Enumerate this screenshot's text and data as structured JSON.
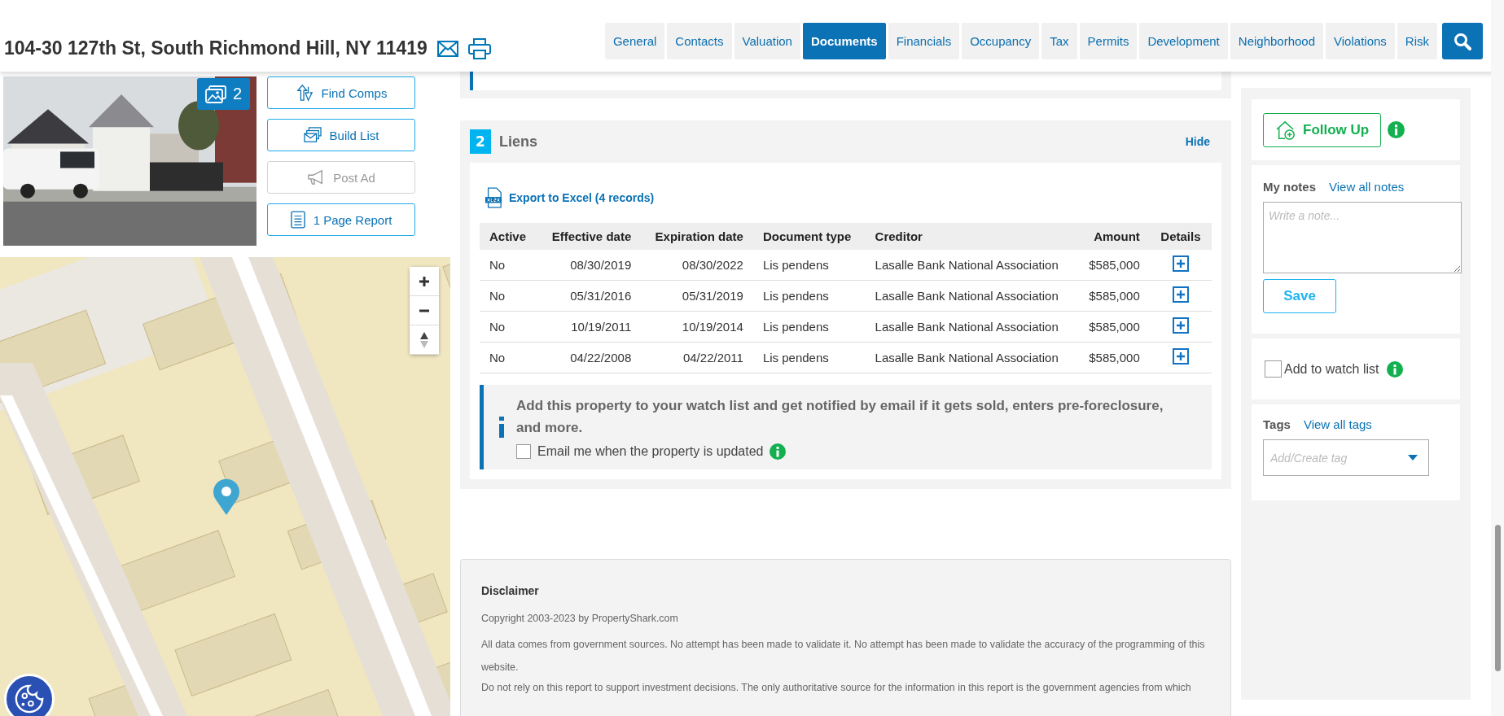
{
  "header": {
    "address": "104-30 127th St, South Richmond Hill, NY 11419"
  },
  "tabs": [
    {
      "label": "General",
      "selected": false
    },
    {
      "label": "Contacts",
      "selected": false
    },
    {
      "label": "Valuation",
      "selected": false
    },
    {
      "label": "Documents",
      "selected": true
    },
    {
      "label": "Financials",
      "selected": false
    },
    {
      "label": "Occupancy",
      "selected": false
    },
    {
      "label": "Tax",
      "selected": false
    },
    {
      "label": "Permits",
      "selected": false
    },
    {
      "label": "Development",
      "selected": false
    },
    {
      "label": "Neighborhood",
      "selected": false
    },
    {
      "label": "Violations",
      "selected": false
    },
    {
      "label": "Risk",
      "selected": false
    }
  ],
  "photo": {
    "gallery_count": "2"
  },
  "actions": [
    {
      "kind": "comps",
      "label": "Find Comps",
      "disabled": false
    },
    {
      "kind": "list",
      "label": "Build List",
      "disabled": false
    },
    {
      "kind": "ad",
      "label": "Post Ad",
      "disabled": true
    },
    {
      "kind": "report",
      "label": "1 Page Report",
      "disabled": false
    }
  ],
  "liens": {
    "number": "2",
    "title": "Liens",
    "hide": "Hide",
    "export": "Export to Excel (4 records)",
    "columns": [
      "Active",
      "Effective date",
      "Expiration date",
      "Document type",
      "Creditor",
      "Amount",
      "Details"
    ],
    "rows": [
      {
        "cells": [
          "No",
          "08/30/2019",
          "08/30/2022",
          "Lis pendens",
          "Lasalle Bank National Association",
          "$585,000"
        ]
      },
      {
        "cells": [
          "No",
          "05/31/2016",
          "05/31/2019",
          "Lis pendens",
          "Lasalle Bank National Association",
          "$585,000"
        ]
      },
      {
        "cells": [
          "No",
          "10/19/2011",
          "10/19/2014",
          "Lis pendens",
          "Lasalle Bank National Association",
          "$585,000"
        ]
      },
      {
        "cells": [
          "No",
          "04/22/2008",
          "04/22/2011",
          "Lis pendens",
          "Lasalle Bank National Association",
          "$585,000"
        ]
      }
    ],
    "watch_prompt": "Add this property to your watch list and get notified by email if it gets sold, enters pre-foreclosure, and more.",
    "email_checkbox": {
      "label": "Email me when the property is updated",
      "checked": false
    }
  },
  "disclaimer": {
    "title": "Disclaimer",
    "paragraphs": [
      "Copyright 2003-2023 by PropertyShark.com",
      "All data comes from government sources. No attempt has been made to validate it. No attempt has been made to validate the accuracy of the programming of this website.",
      "Do not rely on this report to support investment decisions. The only authoritative source for the information in this report is the government agencies from which"
    ]
  },
  "sidebar": {
    "follow_up": "Follow Up",
    "notes": {
      "title": "My notes",
      "link": "View all notes",
      "placeholder": "Write a note...",
      "save": "Save"
    },
    "watch_list": {
      "label": "Add to watch list",
      "checked": false
    },
    "tags": {
      "title": "Tags",
      "link": "View all tags",
      "placeholder": "Add/Create tag"
    }
  }
}
